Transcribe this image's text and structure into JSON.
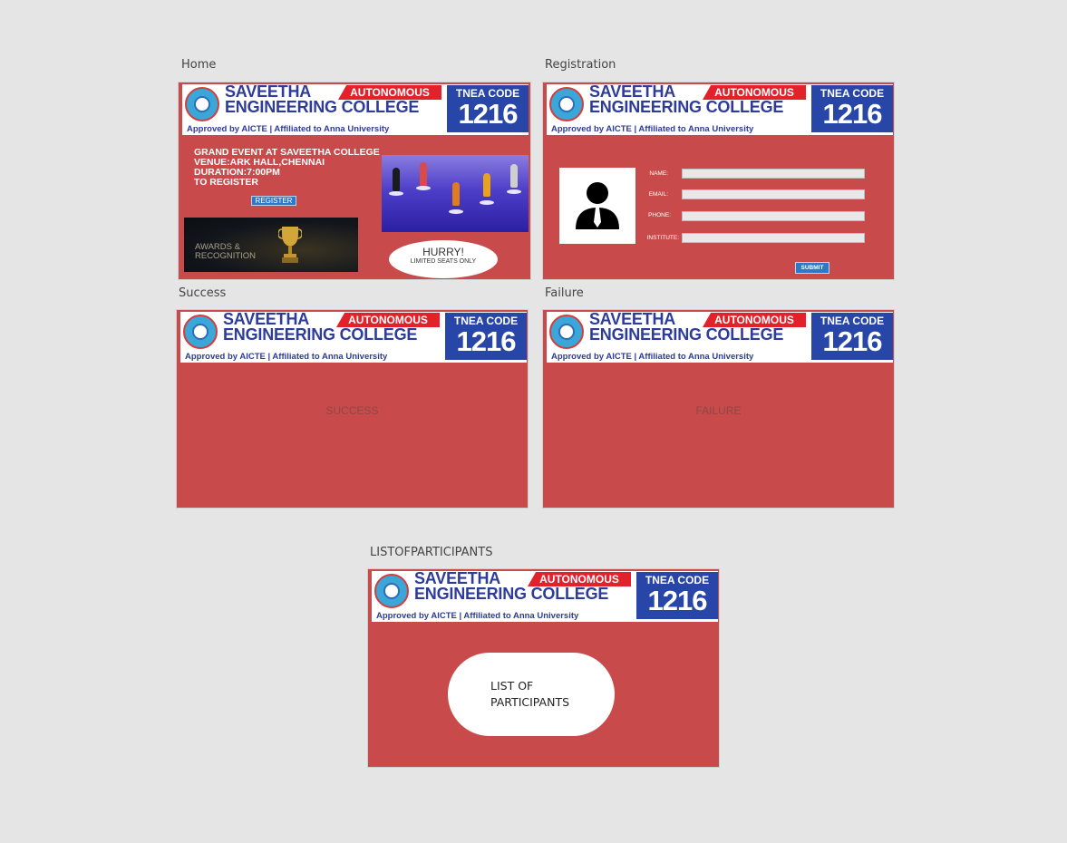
{
  "colors": {
    "frame_bg": "#c94a4a",
    "canvas_bg": "#e5e5e5",
    "college_blue": "#2d3b9a",
    "autonomous_red": "#e2212b",
    "button_blue": "#2c79c9"
  },
  "banner": {
    "college_line1": "SAVEETHA",
    "college_line2": "ENGINEERING COLLEGE",
    "autonomous": "AUTONOMOUS",
    "approved": "Approved by AICTE  |  Affiliated to Anna University",
    "tnea_label": "TNEA CODE",
    "tnea_code": "1216",
    "logo_icon": "college-seal-icon"
  },
  "frames": {
    "home": {
      "label": "Home",
      "event_lines": "GRAND EVENT AT SAVEETHA COLLEGE\nVENUE:ARK HALL,CHENNAI\nDURATION:7:00PM\nTO REGISTER",
      "register_button": "REGISTER",
      "awards_text": "AWARDS &\nRECOGNITION",
      "hurry_title": "HURRY!",
      "hurry_sub": "LIMITED SEATS ONLY"
    },
    "registration": {
      "label": "Registration",
      "avatar_icon": "user-silhouette-icon",
      "fields": [
        {
          "label": "NAME:",
          "value": ""
        },
        {
          "label": "EMAIL:",
          "value": ""
        },
        {
          "label": "PHONE:",
          "value": ""
        },
        {
          "label": "INSTITUTE:",
          "value": ""
        }
      ],
      "submit_button": "SUBMIT"
    },
    "success": {
      "label": "Success",
      "message": "SUCCESS"
    },
    "failure": {
      "label": "Failure",
      "message": "FAILURE"
    },
    "participants": {
      "label": "LISTOFPARTICIPANTS",
      "button_line1": "LIST OF",
      "button_line2": "PARTICIPANTS"
    }
  }
}
